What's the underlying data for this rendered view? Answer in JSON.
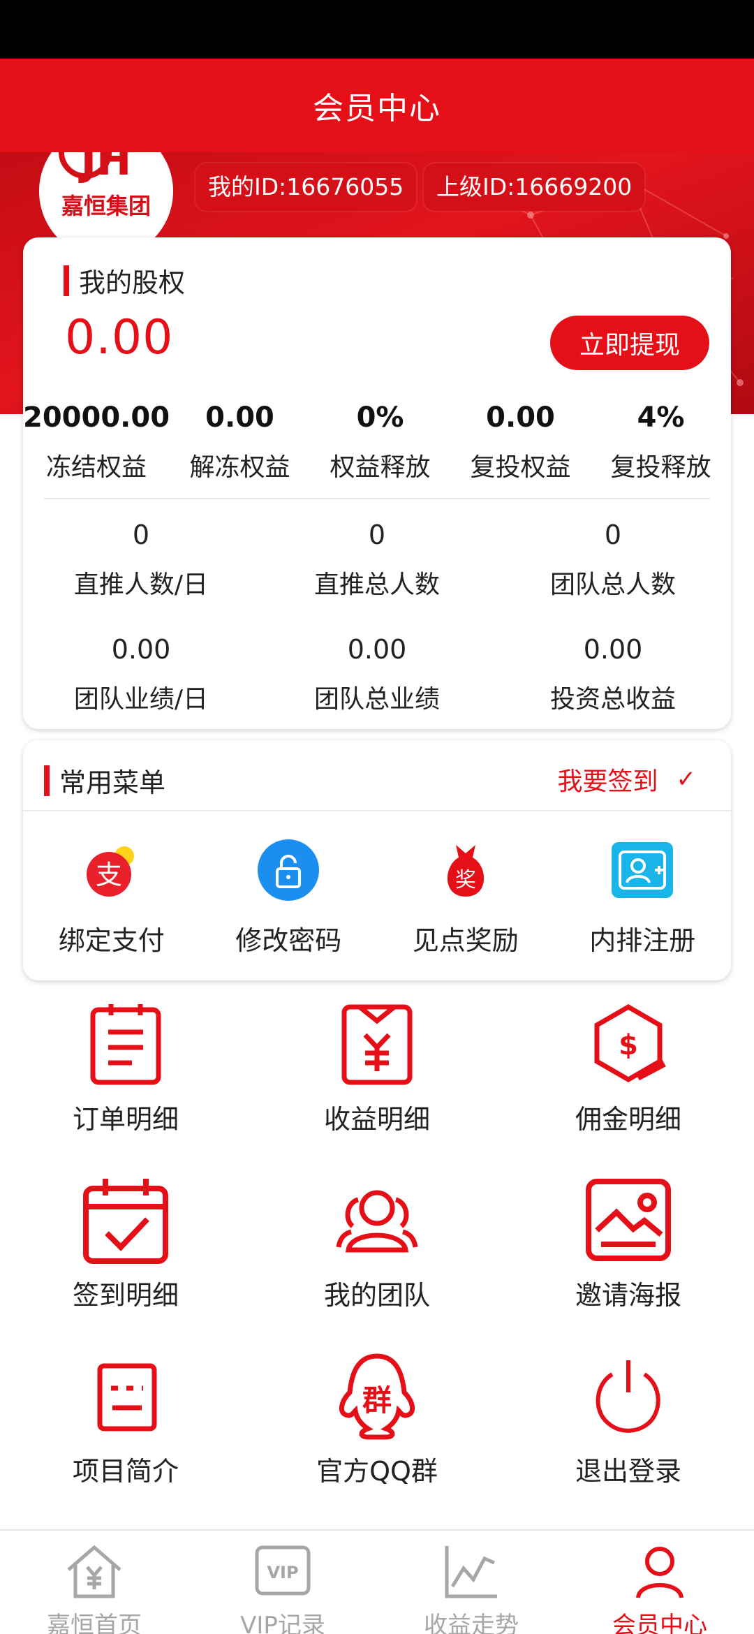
{
  "header": {
    "title": "会员中心"
  },
  "profile": {
    "logo_text": "嘉恒集团",
    "my_id": "我的ID:16676055",
    "parent_id": "上级ID:16669200"
  },
  "equity": {
    "label": "我的股权",
    "value": "0.00",
    "withdraw_label": "立即提现",
    "stats": [
      {
        "value": "20000.00",
        "label": "冻结权益"
      },
      {
        "value": "0.00",
        "label": "解冻权益"
      },
      {
        "value": "0%",
        "label": "权益释放"
      },
      {
        "value": "0.00",
        "label": "复投权益"
      },
      {
        "value": "4%",
        "label": "复投释放"
      }
    ],
    "team_stats": [
      {
        "value": "0",
        "label": "直推人数/日"
      },
      {
        "value": "0",
        "label": "直推总人数"
      },
      {
        "value": "0",
        "label": "团队总人数"
      },
      {
        "value": "0.00",
        "label": "团队业绩/日"
      },
      {
        "value": "0.00",
        "label": "团队总业绩"
      },
      {
        "value": "0.00",
        "label": "投资总收益"
      }
    ]
  },
  "menu": {
    "label": "常用菜单",
    "signin_label": "我要签到",
    "items": [
      {
        "label": "绑定支付",
        "icon": "alipay-icon"
      },
      {
        "label": "修改密码",
        "icon": "lock-icon"
      },
      {
        "label": "见点奖励",
        "icon": "reward-bag-icon"
      },
      {
        "label": "内排注册",
        "icon": "register-card-icon"
      }
    ]
  },
  "grid": [
    {
      "label": "订单明细",
      "icon": "order-icon"
    },
    {
      "label": "收益明细",
      "icon": "income-icon"
    },
    {
      "label": "佣金明细",
      "icon": "commission-icon"
    },
    {
      "label": "签到明细",
      "icon": "calendar-check-icon"
    },
    {
      "label": "我的团队",
      "icon": "team-icon"
    },
    {
      "label": "邀请海报",
      "icon": "poster-icon"
    },
    {
      "label": "项目简介",
      "icon": "project-icon"
    },
    {
      "label": "官方QQ群",
      "icon": "qq-group-icon"
    },
    {
      "label": "退出登录",
      "icon": "power-icon"
    }
  ],
  "tabbar": [
    {
      "label": "嘉恒首页",
      "icon": "home-icon",
      "active": false
    },
    {
      "label": "VIP记录",
      "icon": "vip-icon",
      "active": false
    },
    {
      "label": "收益走势",
      "icon": "trend-icon",
      "active": false
    },
    {
      "label": "会员中心",
      "icon": "user-icon",
      "active": true
    }
  ],
  "colors": {
    "accent": "#e50f18",
    "inactive": "#a6a6a6",
    "alipay_yellow": "#ffd21a",
    "lock_blue": "#1a8ff0",
    "register_cyan": "#19b5e8"
  }
}
